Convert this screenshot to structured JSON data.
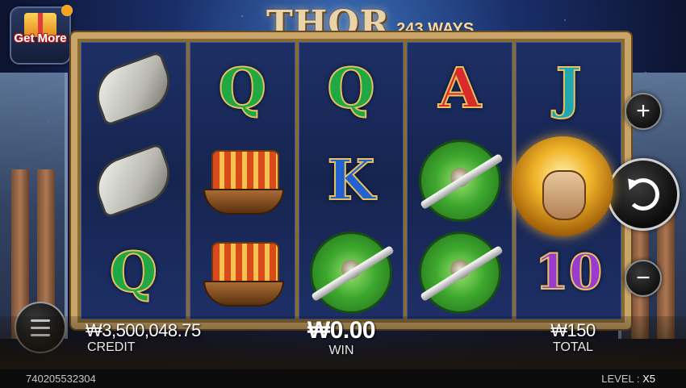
{
  "logo": {
    "title": "THOR",
    "subtitle": "243 WAYS"
  },
  "get_more": {
    "label": "Get More"
  },
  "reels": [
    [
      "horn",
      "horn",
      "Q"
    ],
    [
      "Q",
      "ship",
      "ship"
    ],
    [
      "Q",
      "K",
      "shield"
    ],
    [
      "A",
      "shield",
      "shield"
    ],
    [
      "J",
      "thor",
      "10"
    ]
  ],
  "controls": {
    "plus": "+",
    "minus": "−"
  },
  "hud": {
    "credit_value": "₩3,500,048.75",
    "credit_label": "CREDIT",
    "win_value": "₩0.00",
    "win_label": "WIN",
    "total_value": "₩150",
    "total_label": "TOTAL"
  },
  "status": {
    "round_id": "740205532304",
    "level_label": "LEVEL :",
    "level_value": "X5"
  },
  "colors": {
    "frame_gold": "#c9a56a",
    "reel_bg": "#1d2f66",
    "hud_text": "#ffffff"
  }
}
